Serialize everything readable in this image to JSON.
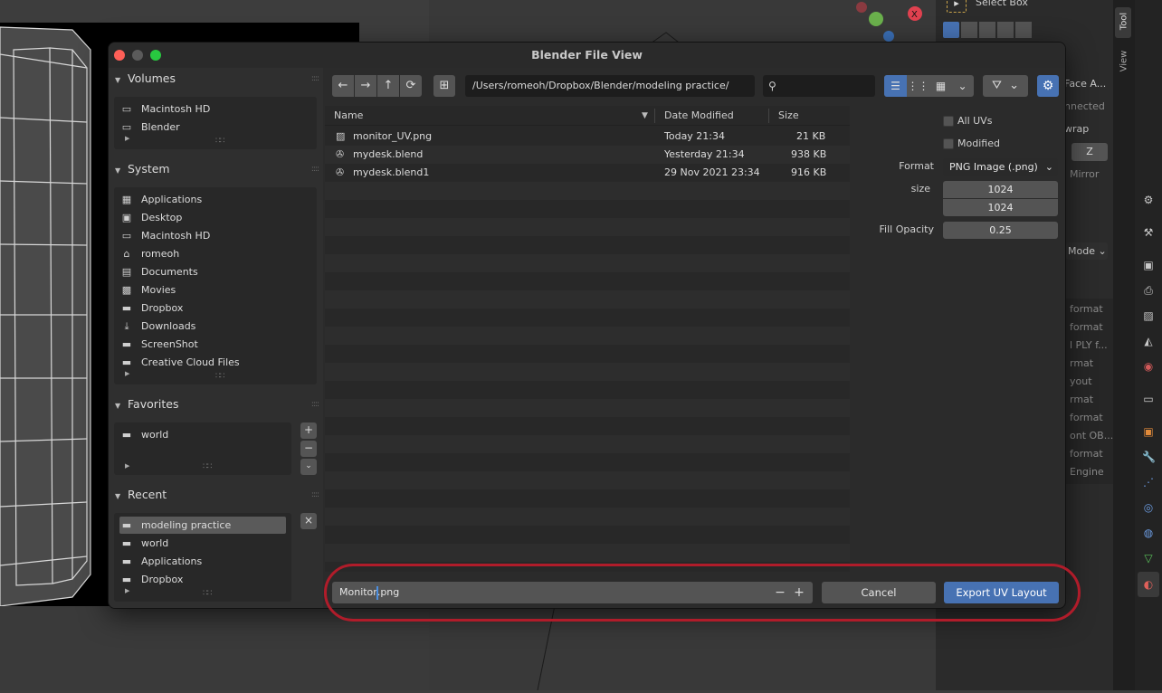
{
  "dialog": {
    "title": "Blender File View"
  },
  "sidebar": {
    "volumes": {
      "title": "Volumes",
      "items": [
        {
          "label": "Macintosh HD",
          "icon": "disk-icon"
        },
        {
          "label": "Blender",
          "icon": "disk-icon"
        }
      ]
    },
    "system": {
      "title": "System",
      "items": [
        {
          "label": "Applications",
          "icon": "app-icon"
        },
        {
          "label": "Desktop",
          "icon": "desktop-icon"
        },
        {
          "label": "Macintosh HD",
          "icon": "disk-icon"
        },
        {
          "label": "romeoh",
          "icon": "home-icon"
        },
        {
          "label": "Documents",
          "icon": "document-icon"
        },
        {
          "label": "Movies",
          "icon": "film-icon"
        },
        {
          "label": "Dropbox",
          "icon": "folder-icon"
        },
        {
          "label": "Downloads",
          "icon": "download-icon"
        },
        {
          "label": "ScreenShot",
          "icon": "folder-icon"
        },
        {
          "label": "Creative Cloud Files",
          "icon": "folder-icon"
        }
      ]
    },
    "favorites": {
      "title": "Favorites",
      "items": [
        {
          "label": "world",
          "icon": "folder-icon"
        }
      ]
    },
    "recent": {
      "title": "Recent",
      "items": [
        {
          "label": "modeling practice",
          "icon": "folder-icon",
          "selected": true
        },
        {
          "label": "world",
          "icon": "folder-icon"
        },
        {
          "label": "Applications",
          "icon": "folder-icon"
        },
        {
          "label": "Dropbox",
          "icon": "folder-icon"
        }
      ]
    }
  },
  "toolbar": {
    "path": "/Users/romeoh/Dropbox/Blender/modeling practice/",
    "search_placeholder": ""
  },
  "filelist": {
    "columns": {
      "name": "Name",
      "date": "Date Modified",
      "size": "Size"
    },
    "rows": [
      {
        "name": "monitor_UV.png",
        "date": "Today 21:34",
        "size": "21 KB",
        "icon": "image-icon"
      },
      {
        "name": "mydesk.blend",
        "date": "Yesterday 21:34",
        "size": "938 KB",
        "icon": "blend-file-icon"
      },
      {
        "name": "mydesk.blend1",
        "date": "29 Nov 2021 23:34",
        "size": "916 KB",
        "icon": "blend-backup-icon"
      }
    ]
  },
  "options": {
    "all_uvs_label": "All UVs",
    "modified_label": "Modified",
    "format_label": "Format",
    "format_value": "PNG Image (.png)",
    "size_label": "size",
    "size_x": "1024",
    "size_y": "1024",
    "fill_opacity_label": "Fill Opacity",
    "fill_opacity_value": "0.25"
  },
  "bottom": {
    "filename_before": "Monitor",
    "filename_after": ".png",
    "cancel_label": "Cancel",
    "export_label": "Export UV Layout"
  },
  "background": {
    "select_box": "Select Box",
    "tab_tool": "Tool",
    "tab_view": "View",
    "face_a": "Face A...",
    "connected": "nnected",
    "wrap": "wrap",
    "z_label": "Z",
    "mirror": "Mirror",
    "mode": "Mode",
    "list": [
      "format",
      "format",
      "l PLY f...",
      "rmat",
      "yout",
      "rmat",
      "format",
      "ont OB...",
      "format",
      "Engine"
    ]
  },
  "colors": {
    "accent": "#4772b3",
    "highlight": "#b01c2a"
  }
}
